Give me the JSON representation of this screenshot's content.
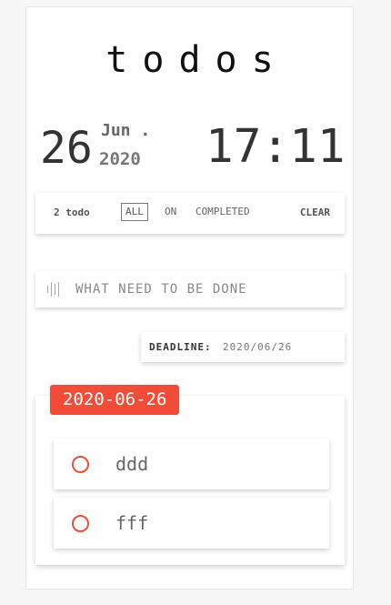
{
  "app": {
    "title": "todos"
  },
  "clock": {
    "day": "26",
    "month": "Jun .",
    "year": "2020",
    "time": "17:11"
  },
  "filters": {
    "count_label": "2 todo",
    "all_label": "ALL",
    "on_label": "ON",
    "completed_label": "COMPLETED",
    "active": "ALL",
    "clear_label": "CLEAR"
  },
  "new_todo": {
    "placeholder": "WHAT NEED TO BE DONE",
    "value": "",
    "icon": "bars-icon"
  },
  "deadline": {
    "label": "DEADLINE:",
    "value": "2020/06/26"
  },
  "groups": [
    {
      "date": "2020-06-26",
      "items": [
        {
          "text": "ddd",
          "completed": false
        },
        {
          "text": "fff",
          "completed": false
        }
      ]
    }
  ],
  "colors": {
    "accent": "#f24c38",
    "background": "#f7f7f7",
    "card": "#ffffff"
  }
}
